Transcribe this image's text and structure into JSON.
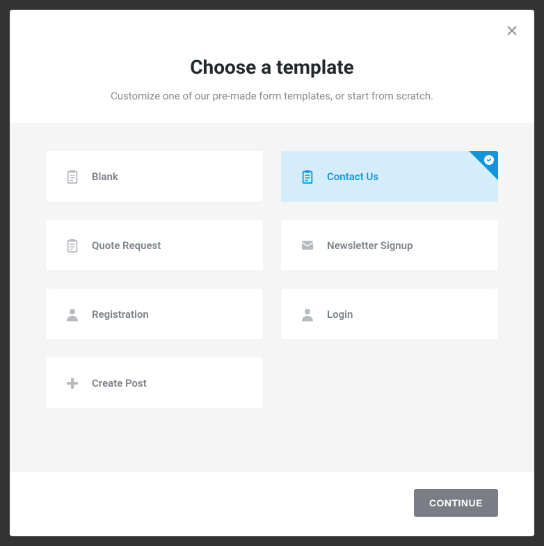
{
  "modal": {
    "title": "Choose a template",
    "subtitle": "Customize one of our pre-made form templates, or start from scratch."
  },
  "templates": [
    {
      "label": "Blank",
      "icon": "clipboard",
      "selected": false
    },
    {
      "label": "Contact Us",
      "icon": "clipboard",
      "selected": true
    },
    {
      "label": "Quote Request",
      "icon": "clipboard",
      "selected": false
    },
    {
      "label": "Newsletter Signup",
      "icon": "mail",
      "selected": false
    },
    {
      "label": "Registration",
      "icon": "person",
      "selected": false
    },
    {
      "label": "Login",
      "icon": "person",
      "selected": false
    },
    {
      "label": "Create Post",
      "icon": "plus",
      "selected": false
    }
  ],
  "footer": {
    "continue_label": "CONTINUE"
  },
  "colors": {
    "accent": "#0f97dd",
    "selected_bg": "#d5edfa"
  }
}
